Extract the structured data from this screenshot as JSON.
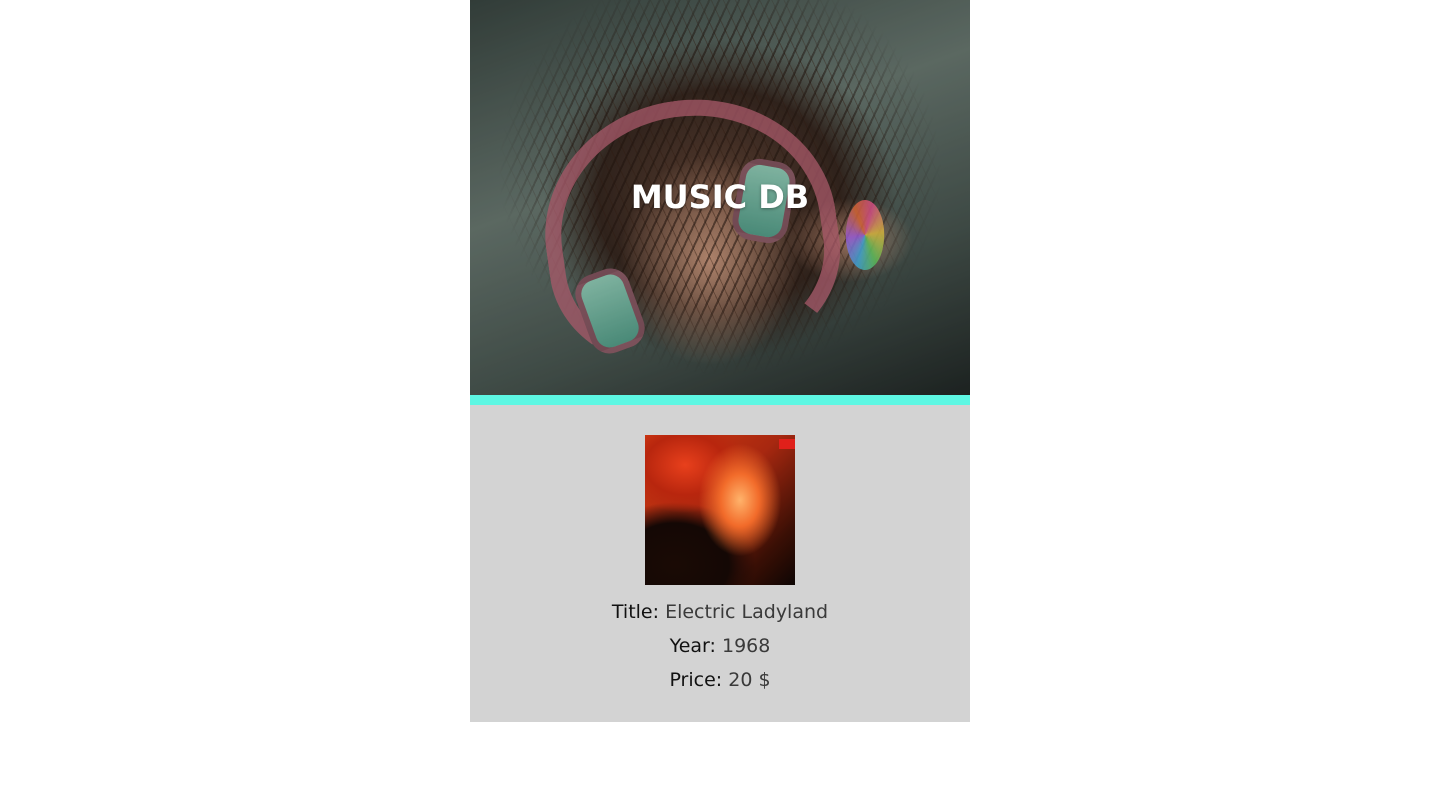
{
  "header": {
    "title": "MUSIC DB",
    "accent_color": "#5df7e3"
  },
  "album": {
    "cover_icon": "album-cover-image",
    "title_label": "Title:",
    "title_value": "Electric Ladyland",
    "year_label": "Year:",
    "year_value": "1968",
    "price_label": "Price:",
    "price_value": "20 $"
  }
}
